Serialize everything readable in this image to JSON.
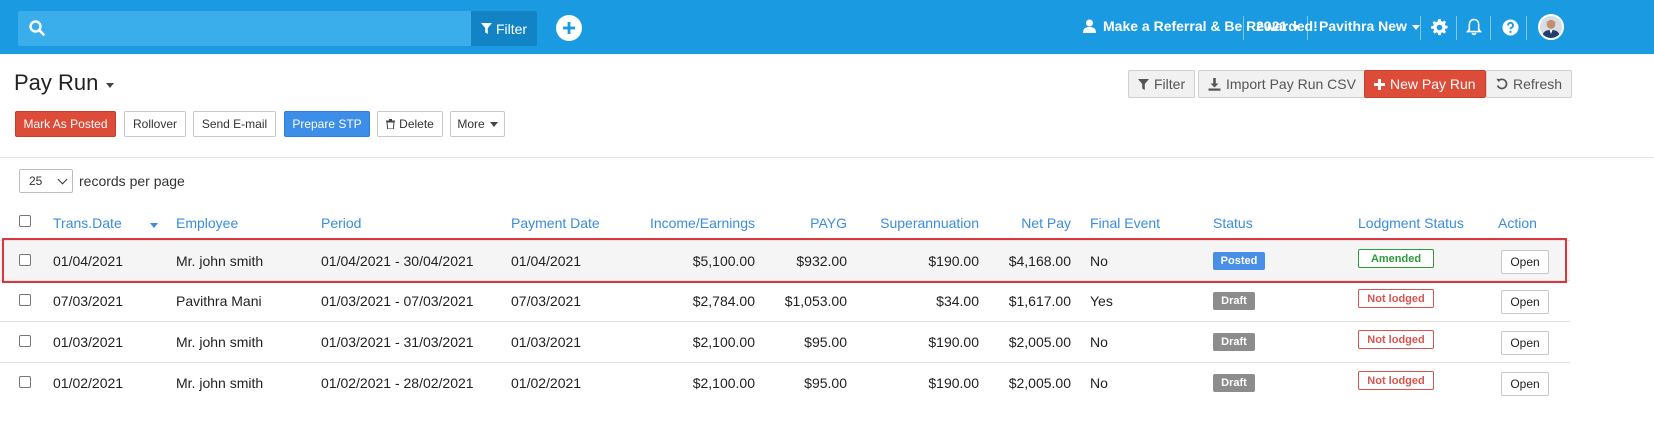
{
  "topbar": {
    "search_placeholder": "",
    "filter_label": "Filter",
    "referral_label": "Make a Referral & Be Rewarded!",
    "year_label": "2021",
    "user_label": "Pavithra New"
  },
  "page": {
    "title": "Pay Run"
  },
  "right_actions": {
    "filter": "Filter",
    "import": "Import Pay Run CSV",
    "new_pay_run": "New Pay Run",
    "refresh": "Refresh"
  },
  "actions": {
    "mark_posted": "Mark As Posted",
    "rollover": "Rollover",
    "send_email": "Send E-mail",
    "prepare_stp": "Prepare STP",
    "delete": "Delete",
    "more": "More"
  },
  "records_per_page": {
    "value": "25",
    "label": "records per page"
  },
  "table": {
    "headers": {
      "trans_date": "Trans.Date",
      "employee": "Employee",
      "period": "Period",
      "payment_date": "Payment Date",
      "income": "Income/Earnings",
      "payg": "PAYG",
      "super": "Superannuation",
      "net_pay": "Net Pay",
      "final_event": "Final Event",
      "status": "Status",
      "lodgment": "Lodgment Status",
      "action": "Action"
    },
    "rows": [
      {
        "trans_date": "01/04/2021",
        "employee": "Mr. john smith",
        "period": "01/04/2021 - 30/04/2021",
        "payment_date": "01/04/2021",
        "income": "$5,100.00",
        "payg": "$932.00",
        "super": "$190.00",
        "net_pay": "$4,168.00",
        "final_event": "No",
        "status": "Posted",
        "lodgment": "Amended",
        "action": "Open"
      },
      {
        "trans_date": "07/03/2021",
        "employee": "Pavithra Mani",
        "period": "01/03/2021 - 07/03/2021",
        "payment_date": "07/03/2021",
        "income": "$2,784.00",
        "payg": "$1,053.00",
        "super": "$34.00",
        "net_pay": "$1,617.00",
        "final_event": "Yes",
        "status": "Draft",
        "lodgment": "Not lodged",
        "action": "Open"
      },
      {
        "trans_date": "01/03/2021",
        "employee": "Mr. john smith",
        "period": "01/03/2021 - 31/03/2021",
        "payment_date": "01/03/2021",
        "income": "$2,100.00",
        "payg": "$95.00",
        "super": "$190.00",
        "net_pay": "$2,005.00",
        "final_event": "No",
        "status": "Draft",
        "lodgment": "Not lodged",
        "action": "Open"
      },
      {
        "trans_date": "01/02/2021",
        "employee": "Mr. john smith",
        "period": "01/02/2021 - 28/02/2021",
        "payment_date": "01/02/2021",
        "income": "$2,100.00",
        "payg": "$95.00",
        "super": "$190.00",
        "net_pay": "$2,005.00",
        "final_event": "No",
        "status": "Draft",
        "lodgment": "Not lodged",
        "action": "Open"
      }
    ]
  },
  "colors": {
    "topbar": "#1a9ae0",
    "link": "#3a8dde",
    "danger": "#dd4b39",
    "primary": "#3c8ee9",
    "success": "#2e9a3c",
    "highlight_frame": "#d9363e"
  }
}
